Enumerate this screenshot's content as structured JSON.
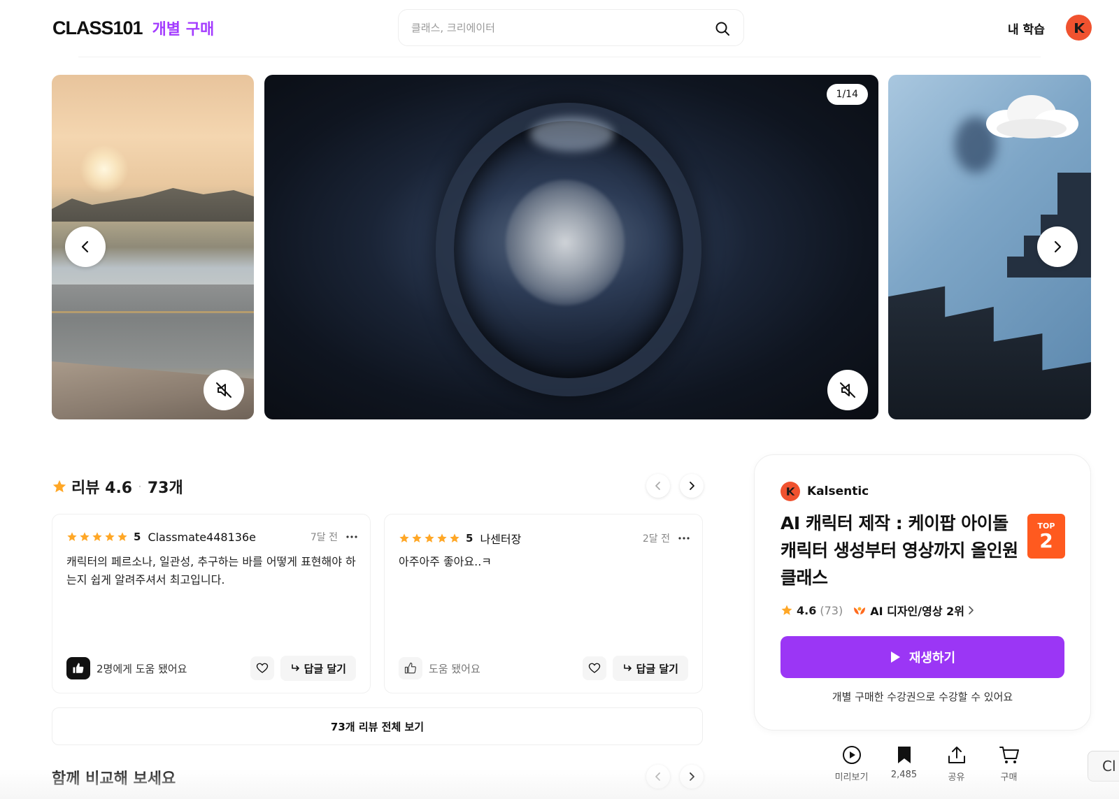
{
  "header": {
    "logo": "CLASS101",
    "logo_sub": "개별 구매",
    "search_placeholder": "클래스, 크리에이터",
    "my_learning": "내 학습"
  },
  "carousel": {
    "counter": "1/14"
  },
  "reviews": {
    "title": "리뷰 4.6",
    "count": "73개",
    "items": [
      {
        "score": "5",
        "user": "Classmate448136e",
        "time": "7달 전",
        "body": "캐릭터의 페르소나, 일관성, 추구하는 바를 어떻게 표현해야 하는지 쉽게 알려주셔서 최고입니다.",
        "helped": "2명에게 도움 됐어요",
        "reply": "답글 달기"
      },
      {
        "score": "5",
        "user": "나센터장",
        "time": "2달 전",
        "body": "아주아주 좋아요..ㅋ",
        "helped": "도움 됐어요",
        "reply": "답글 달기"
      }
    ],
    "view_all": "73개 리뷰 전체 보기"
  },
  "compare": {
    "title": "함께 비교해 보세요"
  },
  "course": {
    "creator": "Kalsentic",
    "title": "AI 캐릭터 제작 : 케이팝 아이돌 캐릭터 생성부터 영상까지 올인원 클래스",
    "badge_label": "TOP",
    "badge_rank": "2",
    "rating": "4.6",
    "rating_count": "(73)",
    "rank_text": "AI 디자인/영상 2위",
    "play_label": "재생하기",
    "note": "개별 구매한 수강권으로 수강할 수 있어요"
  },
  "actions": [
    {
      "label": "미리보기",
      "icon": "play-circle-icon"
    },
    {
      "label": "2,485",
      "icon": "bookmark-icon"
    },
    {
      "label": "공유",
      "icon": "share-icon"
    },
    {
      "label": "구매",
      "icon": "cart-icon"
    }
  ],
  "floating": {
    "text": "Cl"
  },
  "colors": {
    "brand_purple": "#9b36f5",
    "logo_sub": "#a43cff",
    "star": "#ffa726",
    "top_badge": "#ff5a1f",
    "avatar": "#f0522f"
  }
}
